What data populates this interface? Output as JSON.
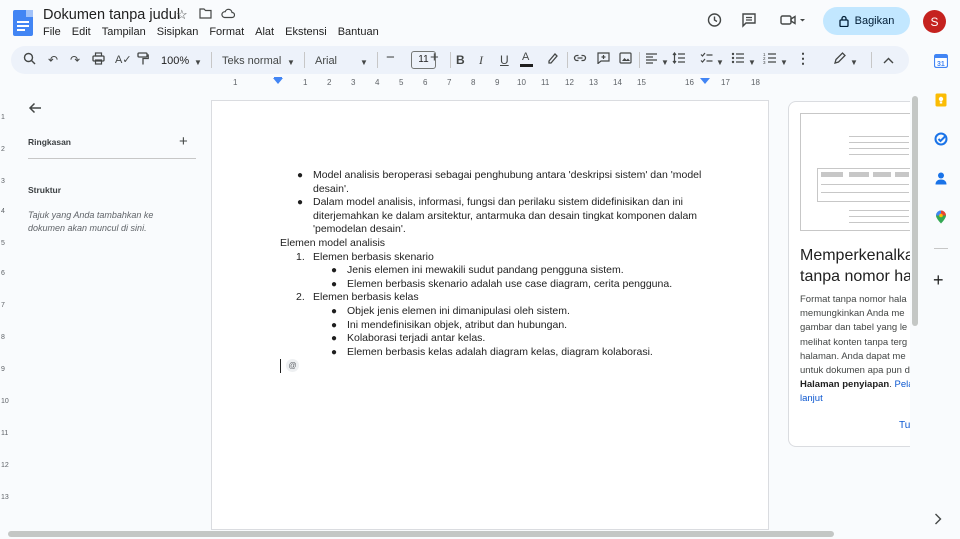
{
  "app": {
    "doc_title": "Dokumen tanpa judul",
    "menu": [
      "File",
      "Edit",
      "Tampilan",
      "Sisipkan",
      "Format",
      "Alat",
      "Ekstensi",
      "Bantuan"
    ],
    "share_label": "Bagikan",
    "avatar_initial": "S"
  },
  "toolbar": {
    "zoom": "100%",
    "style": "Teks normal",
    "font": "Arial",
    "font_size": "11"
  },
  "ruler": {
    "h_ticks": [
      "1",
      "2",
      "3",
      "4",
      "5",
      "6",
      "7",
      "8",
      "9",
      "10",
      "11",
      "12",
      "13",
      "14",
      "15",
      "16",
      "17",
      "18"
    ],
    "v_ticks": [
      "1",
      "2",
      "3",
      "4",
      "5",
      "6",
      "7",
      "8",
      "9",
      "10",
      "11",
      "12",
      "13"
    ]
  },
  "outline": {
    "summary_label": "Ringkasan",
    "structure_label": "Struktur",
    "structure_hint": "Tajuk yang Anda tambahkan ke dokumen akan muncul di sini."
  },
  "document": {
    "bullets_top": [
      "Model analisis beroperasi sebagai penghubung antara 'deskripsi sistem' dan 'model desain'.",
      "Dalam model analisis, informasi, fungsi dan perilaku sistem didefinisikan dan ini diterjemahkan ke dalam arsitektur, antarmuka dan desain tingkat komponen dalam 'pemodelan desain'."
    ],
    "heading": "Elemen model analisis",
    "numbered": [
      {
        "num": "1.",
        "label": "Elemen berbasis skenario",
        "sub": [
          "Jenis elemen ini mewakili sudut pandang pengguna sistem.",
          "Elemen berbasis skenario adalah use case diagram, cerita pengguna."
        ]
      },
      {
        "num": "2.",
        "label": "Elemen berbasis kelas",
        "sub": [
          "Objek jenis elemen ini dimanipulasi oleh sistem.",
          "Ini mendefinisikan objek, atribut dan hubungan.",
          "Kolaborasi terjadi antar kelas.",
          "Elemen berbasis kelas adalah diagram kelas, diagram kolaborasi."
        ]
      }
    ],
    "at_chip": "@"
  },
  "promo": {
    "title_line1": "Memperkenalka",
    "title_line2": "tanpa nomor ha",
    "body_lines": [
      "Format tanpa nomor hala",
      "memungkinkan Anda me",
      "gambar dan tabel yang le",
      "melihat konten tanpa terg",
      "halaman. Anda dapat me",
      "untuk dokumen apa pun d"
    ],
    "body_bold": "Halaman penyiapan",
    "body_link_a": "Pela",
    "body_link_b": "lanjut",
    "action": "Tu"
  },
  "colors": {
    "accent": "#0b57d0",
    "share_bg": "#c2e7ff",
    "avatar_bg": "#c5221f",
    "doc_icon": "#4285f4"
  }
}
